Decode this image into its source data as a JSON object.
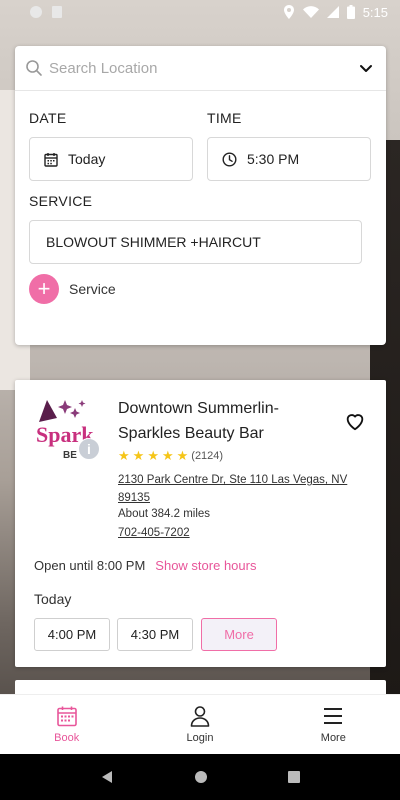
{
  "status_bar": {
    "time": "5:15"
  },
  "search": {
    "placeholder": "Search Location",
    "date_label": "DATE",
    "date_value": "Today",
    "time_label": "TIME",
    "time_value": "5:30 PM",
    "service_label": "SERVICE",
    "service_value": "BLOWOUT SHIMMER +HAIRCUT",
    "add_service_label": "Service"
  },
  "salon": {
    "name": "Downtown Summerlin- Sparkles Beauty Bar",
    "rating": 5,
    "review_count": "(2124)",
    "address": "2130 Park Centre Dr, Ste 110 Las Vegas, NV 89135",
    "distance": "About 384.2 miles",
    "phone": "702-405-7202",
    "open_until": "Open until 8:00 PM",
    "show_hours": "Show store hours",
    "day_label": "Today",
    "slots": [
      "4:00 PM",
      "4:30 PM"
    ],
    "more_label": "More",
    "logo_text": "Sparkles BEAUTY"
  },
  "nav": {
    "items": [
      {
        "label": "Book",
        "icon": "calendar-icon"
      },
      {
        "label": "Login",
        "icon": "user-icon"
      },
      {
        "label": "More",
        "icon": "menu-icon"
      }
    ]
  },
  "colors": {
    "accent": "#f06ea7",
    "star": "#f5c518"
  }
}
